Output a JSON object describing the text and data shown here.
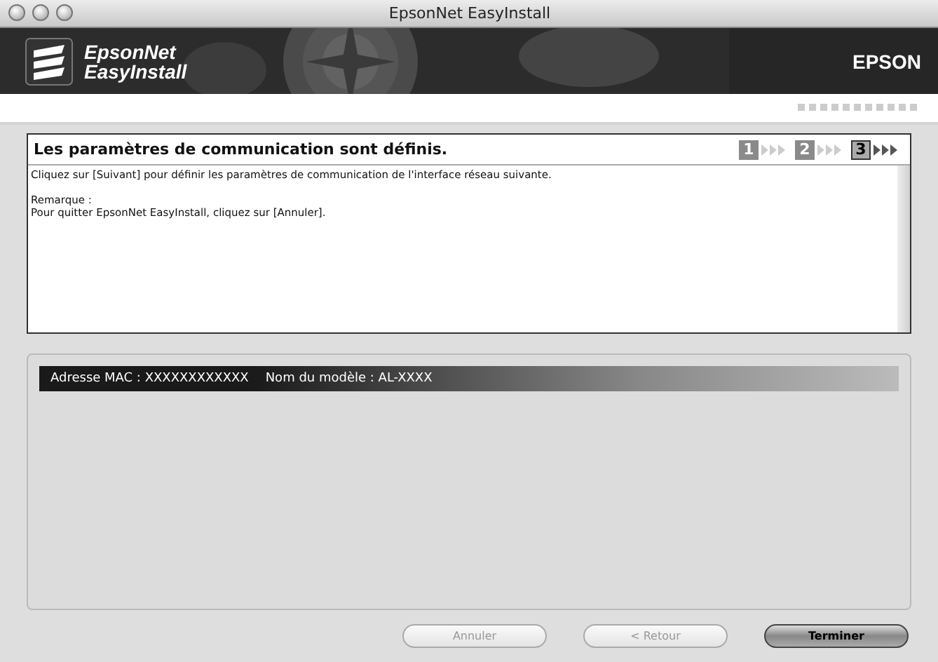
{
  "window": {
    "title": "EpsonNet EasyInstall"
  },
  "banner": {
    "product_line1": "EpsonNet",
    "product_line2": "EasyInstall",
    "brand": "EPSON"
  },
  "message": {
    "heading": "Les paramètres de communication sont définis.",
    "steps": [
      {
        "label": "1",
        "selected": false
      },
      {
        "label": "2",
        "selected": false
      },
      {
        "label": "3",
        "selected": true
      }
    ],
    "paragraphs": [
      [
        "Cliquez sur [Suivant] pour définir les paramètres de communication de l'interface réseau suivante."
      ],
      [
        "Remarque :",
        "Pour quitter EpsonNet EasyInstall, cliquez sur [Annuler]."
      ]
    ]
  },
  "device_list": {
    "rows": [
      {
        "mac": "Adresse MAC : XXXXXXXXXXXX",
        "model": "Nom du modèle : AL-XXXX",
        "selected": true
      }
    ]
  },
  "buttons": [
    {
      "label": "Annuler",
      "disabled": true,
      "default": false
    },
    {
      "label": "< Retour",
      "disabled": true,
      "default": false
    },
    {
      "label": "Terminer",
      "disabled": false,
      "default": true
    }
  ]
}
